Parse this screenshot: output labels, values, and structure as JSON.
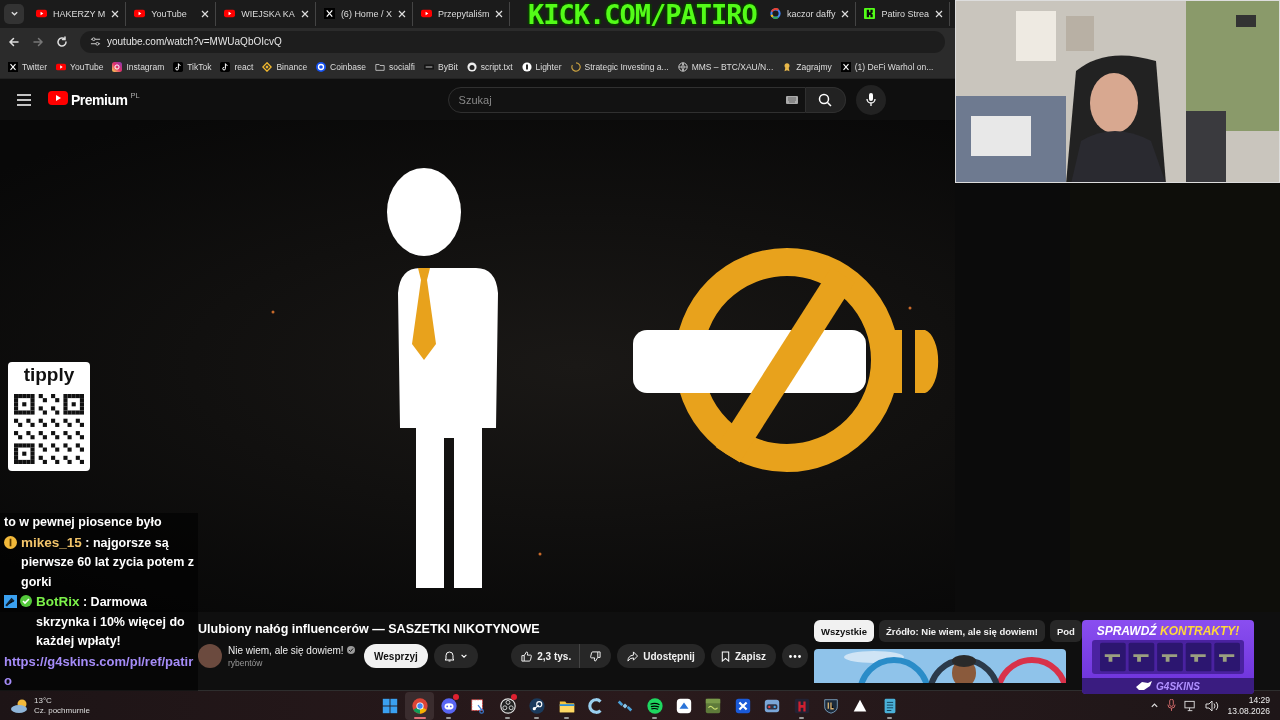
{
  "tabs": [
    {
      "title": "HAKERZY M",
      "kind": "youtube"
    },
    {
      "title": "YouTube",
      "kind": "youtube"
    },
    {
      "title": "WIEJSKA KA",
      "kind": "youtube"
    },
    {
      "title": "(6) Home / X",
      "kind": "x"
    },
    {
      "title": "Przepytaliśm",
      "kind": "youtube"
    }
  ],
  "tabs_after_banner": [
    {
      "title": "kaczor daffy",
      "kind": "google"
    },
    {
      "title": "Patiro Strea",
      "kind": "kick"
    }
  ],
  "stream_banner": "KICK.COM/PATIRO",
  "address_bar": {
    "url": "youtube.com/watch?v=MWUaQbOIcvQ"
  },
  "bookmarks": [
    {
      "label": "Twitter",
      "kind": "x"
    },
    {
      "label": "YouTube",
      "kind": "youtube"
    },
    {
      "label": "Instagram",
      "kind": "instagram"
    },
    {
      "label": "TikTok",
      "kind": "tiktok"
    },
    {
      "label": "react",
      "kind": "tiktok"
    },
    {
      "label": "Binance",
      "kind": "binance"
    },
    {
      "label": "Coinbase",
      "kind": "coinbase"
    },
    {
      "label": "socialfi",
      "kind": "folder"
    },
    {
      "label": "ByBit",
      "kind": "bybit"
    },
    {
      "label": "script.txt",
      "kind": "github"
    },
    {
      "label": "Lighter",
      "kind": "lighter"
    },
    {
      "label": "Strategic Investing a...",
      "kind": "spinner"
    },
    {
      "label": "MMS – BTC/XAU/N...",
      "kind": "globe"
    },
    {
      "label": "Zagrajmy",
      "kind": "medal"
    },
    {
      "label": "(1) DeFi Warhol on...",
      "kind": "x"
    }
  ],
  "youtube_header": {
    "logo": "Premium",
    "region": "PL",
    "search_placeholder": "Szukaj"
  },
  "video_info": {
    "title": "Ulubiony nałóg influencerów — SASZETKI NIKOTYNOWE",
    "channel": "Nie wiem, ale się dowiem!",
    "verified": true,
    "subscribers": "rybentów",
    "support": "Wesprzyj",
    "likes": "2,3 tys.",
    "share": "Udostępnij",
    "save": "Zapisz"
  },
  "chips": [
    {
      "label": "Wszystkie",
      "selected": true
    },
    {
      "label": "Źródło: Nie wiem, ale się dowiem!",
      "selected": false
    },
    {
      "label": "Pod",
      "selected": false
    }
  ],
  "chat": [
    {
      "kind": "plain",
      "text": "to w pewnej piosence było"
    },
    {
      "kind": "coin",
      "user": "mikes_15",
      "color": "#f2c46a",
      "text": ": najgorsze są pierwsze 60 lat zycia potem z gorki"
    },
    {
      "kind": "bot",
      "user": "BotRix",
      "color": "#7cf24a",
      "text": ": Darmowa skrzynka i 10% więcej do każdej wpłaty!",
      "link": "https://g4skins.com/pl/ref/patiro"
    }
  ],
  "tipply": {
    "logo": "tipply"
  },
  "ad": {
    "headline": "SPRAWDŹ",
    "headline_accent": "KONTRAKTY!",
    "brand": "G4SKINS"
  },
  "taskbar": {
    "weather": {
      "temp": "13°C",
      "condition": "Cz. pochmurnie"
    },
    "apps": [
      {
        "kind": "windows",
        "running": false,
        "active": false,
        "notification": false
      },
      {
        "kind": "chrome",
        "running": true,
        "active": true,
        "notification": false
      },
      {
        "kind": "discord",
        "running": true,
        "active": false,
        "notification": true
      },
      {
        "kind": "snip",
        "running": false,
        "active": false,
        "notification": false
      },
      {
        "kind": "obs",
        "running": true,
        "active": false,
        "notification": true
      },
      {
        "kind": "steam",
        "running": true,
        "active": false,
        "notification": false
      },
      {
        "kind": "explorer",
        "running": true,
        "active": false,
        "notification": false
      },
      {
        "kind": "ccleaner",
        "running": false,
        "active": false,
        "notification": false
      },
      {
        "kind": "satellite",
        "running": false,
        "active": false,
        "notification": false
      },
      {
        "kind": "spotify",
        "running": true,
        "active": false,
        "notification": false
      },
      {
        "kind": "cloud",
        "running": false,
        "active": false,
        "notification": false
      },
      {
        "kind": "block",
        "running": false,
        "active": false,
        "notification": false
      },
      {
        "kind": "cross",
        "running": false,
        "active": false,
        "notification": false
      },
      {
        "kind": "gamepad",
        "running": false,
        "active": false,
        "notification": false
      },
      {
        "kind": "redapp",
        "running": true,
        "active": false,
        "notification": false
      },
      {
        "kind": "rl",
        "running": false,
        "active": false,
        "notification": false
      },
      {
        "kind": "triangle",
        "running": false,
        "active": false,
        "notification": false
      },
      {
        "kind": "notepad",
        "running": true,
        "active": false,
        "notification": false
      }
    ],
    "time": "14:29",
    "date": "13.08.2026"
  }
}
